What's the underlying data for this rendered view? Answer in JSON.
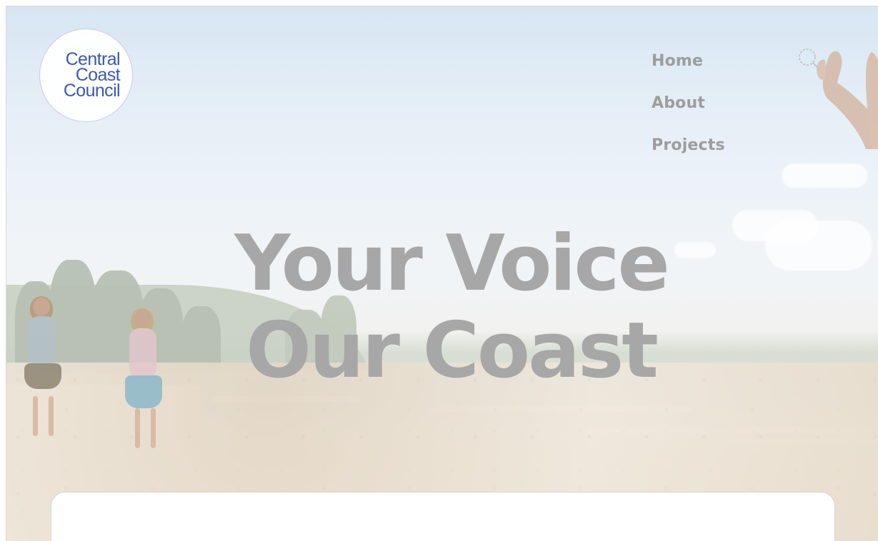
{
  "logo": {
    "line1": "Central",
    "line2": "Coast",
    "line3": "Council"
  },
  "navigation": {
    "items": [
      {
        "label": "Home"
      },
      {
        "label": "About"
      },
      {
        "label": "Projects"
      }
    ],
    "search_icon": "search-icon"
  },
  "hero": {
    "title_line_1": "Your Voice",
    "title_line_2": "Our Coast"
  },
  "colors": {
    "logo_text": "#3c58b5",
    "nav_text": "#9d9d9d",
    "hero_title": "#a7a7a7",
    "sky": "#d7e6f3",
    "sand": "#ede6da"
  }
}
